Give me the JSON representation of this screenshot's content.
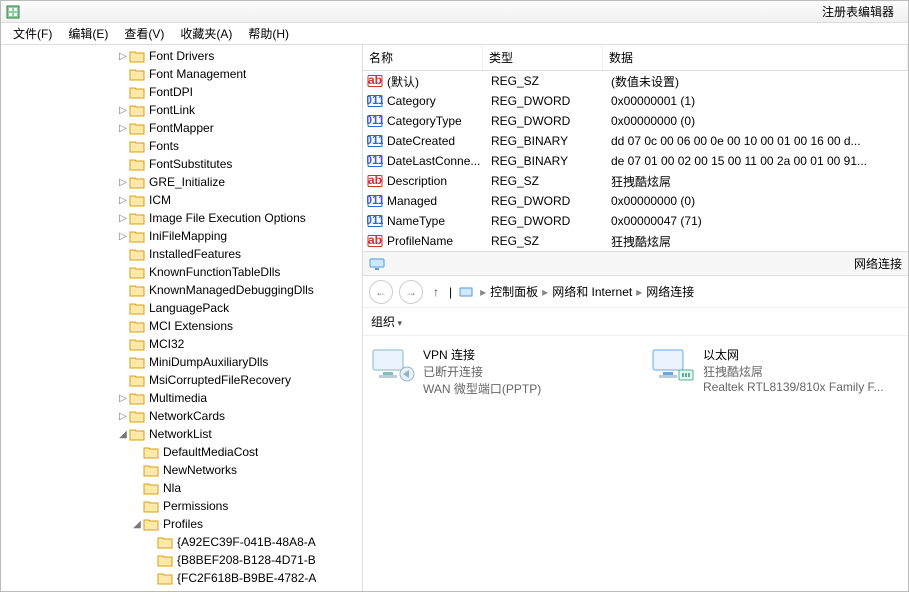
{
  "window": {
    "title": "注册表编辑器"
  },
  "menu": [
    "文件(F)",
    "编辑(E)",
    "查看(V)",
    "收藏夹(A)",
    "帮助(H)"
  ],
  "tree": [
    {
      "d": 8,
      "e": "▷",
      "l": "Font Drivers"
    },
    {
      "d": 8,
      "e": "",
      "l": "Font Management"
    },
    {
      "d": 8,
      "e": "",
      "l": "FontDPI"
    },
    {
      "d": 8,
      "e": "▷",
      "l": "FontLink"
    },
    {
      "d": 8,
      "e": "▷",
      "l": "FontMapper"
    },
    {
      "d": 8,
      "e": "",
      "l": "Fonts"
    },
    {
      "d": 8,
      "e": "",
      "l": "FontSubstitutes"
    },
    {
      "d": 8,
      "e": "▷",
      "l": "GRE_Initialize"
    },
    {
      "d": 8,
      "e": "▷",
      "l": "ICM"
    },
    {
      "d": 8,
      "e": "▷",
      "l": "Image File Execution Options"
    },
    {
      "d": 8,
      "e": "▷",
      "l": "IniFileMapping"
    },
    {
      "d": 8,
      "e": "",
      "l": "InstalledFeatures"
    },
    {
      "d": 8,
      "e": "",
      "l": "KnownFunctionTableDlls"
    },
    {
      "d": 8,
      "e": "",
      "l": "KnownManagedDebuggingDlls"
    },
    {
      "d": 8,
      "e": "",
      "l": "LanguagePack"
    },
    {
      "d": 8,
      "e": "",
      "l": "MCI Extensions"
    },
    {
      "d": 8,
      "e": "",
      "l": "MCI32"
    },
    {
      "d": 8,
      "e": "",
      "l": "MiniDumpAuxiliaryDlls"
    },
    {
      "d": 8,
      "e": "",
      "l": "MsiCorruptedFileRecovery"
    },
    {
      "d": 8,
      "e": "▷",
      "l": "Multimedia"
    },
    {
      "d": 8,
      "e": "▷",
      "l": "NetworkCards"
    },
    {
      "d": 8,
      "e": "◢",
      "l": "NetworkList"
    },
    {
      "d": 9,
      "e": "",
      "l": "DefaultMediaCost"
    },
    {
      "d": 9,
      "e": "",
      "l": "NewNetworks"
    },
    {
      "d": 9,
      "e": "",
      "l": "Nla"
    },
    {
      "d": 9,
      "e": "",
      "l": "Permissions"
    },
    {
      "d": 9,
      "e": "◢",
      "l": "Profiles"
    },
    {
      "d": 10,
      "e": "",
      "l": "{A92EC39F-041B-48A8-A"
    },
    {
      "d": 10,
      "e": "",
      "l": "{B8BEF208-B128-4D71-B"
    },
    {
      "d": 10,
      "e": "",
      "l": "{FC2F618B-B9BE-4782-A"
    }
  ],
  "reg": {
    "cols": {
      "name": "名称",
      "type": "类型",
      "data": "数据"
    },
    "rows": [
      {
        "icon": "sz",
        "name": "(默认)",
        "type": "REG_SZ",
        "data": "(数值未设置)"
      },
      {
        "icon": "dw",
        "name": "Category",
        "type": "REG_DWORD",
        "data": "0x00000001 (1)"
      },
      {
        "icon": "dw",
        "name": "CategoryType",
        "type": "REG_DWORD",
        "data": "0x00000000 (0)"
      },
      {
        "icon": "dw",
        "name": "DateCreated",
        "type": "REG_BINARY",
        "data": "dd 07 0c 00 06 00 0e 00 10 00 01 00 16 00 d..."
      },
      {
        "icon": "dw",
        "name": "DateLastConne...",
        "type": "REG_BINARY",
        "data": "de 07 01 00 02 00 15 00 11 00 2a 00 01 00 91..."
      },
      {
        "icon": "sz",
        "name": "Description",
        "type": "REG_SZ",
        "data": "狂拽酷炫屌"
      },
      {
        "icon": "dw",
        "name": "Managed",
        "type": "REG_DWORD",
        "data": "0x00000000 (0)"
      },
      {
        "icon": "dw",
        "name": "NameType",
        "type": "REG_DWORD",
        "data": "0x00000047 (71)"
      },
      {
        "icon": "sz",
        "name": "ProfileName",
        "type": "REG_SZ",
        "data": "狂拽酷炫屌"
      }
    ]
  },
  "explorer": {
    "title": "网络连接",
    "crumbs": [
      "控制面板",
      "网络和 Internet",
      "网络连接"
    ],
    "organize": "组织",
    "items": [
      {
        "name": "VPN 连接",
        "status": "已断开连接",
        "detail": "WAN 微型端口(PPTP)",
        "kind": "vpn"
      },
      {
        "name": "以太网",
        "status": "狂拽酷炫屌",
        "detail": "Realtek RTL8139/810x Family F...",
        "kind": "eth"
      }
    ]
  }
}
